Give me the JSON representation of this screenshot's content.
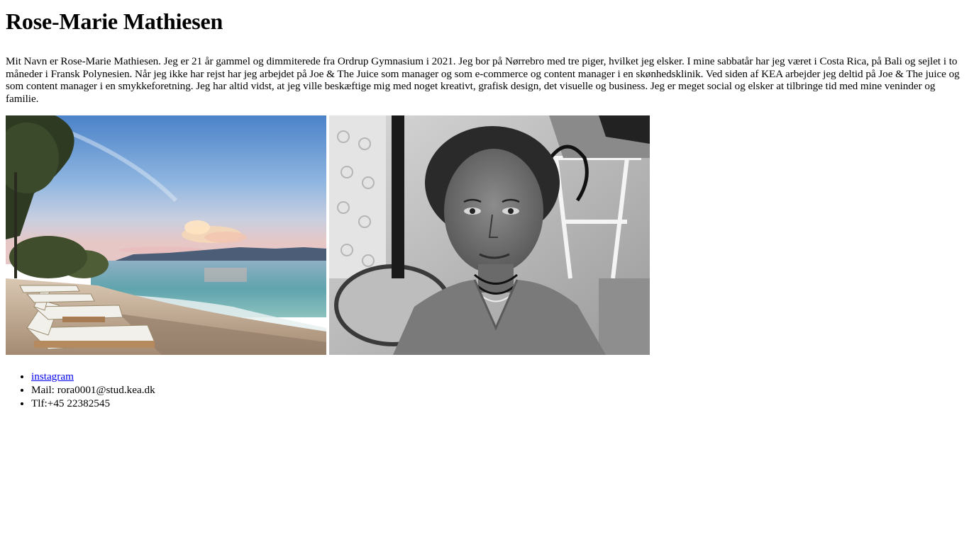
{
  "page": {
    "title": "Rose-Marie Mathiesen",
    "bio": "Mit Navn er Rose-Marie Mathiesen. Jeg er 21 år gammel og dimmiterede fra Ordrup Gymnasium i 2021. Jeg bor på Nørrebro med tre piger, hvilket jeg elsker. I mine sabbatår har jeg været i Costa Rica, på Bali og sejlet i to måneder i Fransk Polynesien. Når jeg ikke har rejst har jeg arbejdet på Joe & The Juice som manager og som e-commerce og content manager i en skønhedsklinik. Ved siden af KEA arbejder jeg deltid på Joe & The juice og som content manager i en smykkeforetning. Jeg har altid vidst, at jeg ville beskæftige mig med noget kreativt, grafisk design, det visuelle og business. Jeg er meget social og elsker at tilbringe tid med mine veninder og familie."
  },
  "gallery": {
    "images": [
      {
        "name": "beach-sunset-photo"
      },
      {
        "name": "portrait-photo"
      }
    ]
  },
  "contact": {
    "instagram_label": "instagram",
    "mail": "Mail: rora0001@stud.kea.dk",
    "phone": "Tlf:+45 22382545"
  }
}
